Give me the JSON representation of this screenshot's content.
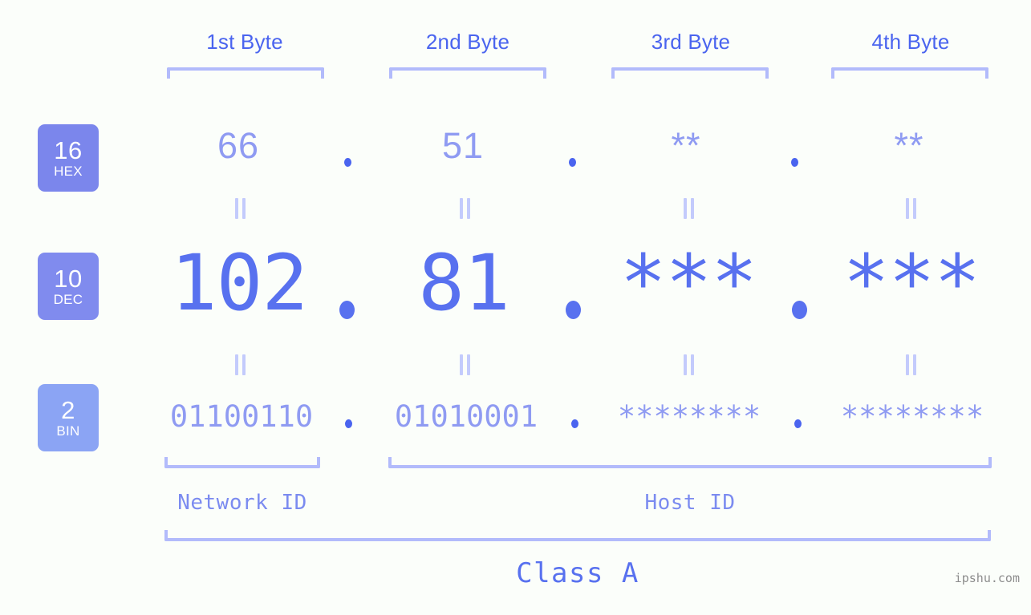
{
  "watermark": "ipshu.com",
  "byte_headings": [
    {
      "label": "1st Byte"
    },
    {
      "label": "2nd Byte"
    },
    {
      "label": "3rd Byte"
    },
    {
      "label": "4th Byte"
    }
  ],
  "bases": [
    {
      "number": "16",
      "name": "HEX",
      "color": "#7b86ec"
    },
    {
      "number": "10",
      "name": "DEC",
      "color": "#808bee"
    },
    {
      "number": "2",
      "name": "BIN",
      "color": "#8ba4f4"
    }
  ],
  "rows": {
    "hex": {
      "base_number": "16",
      "base_name": "HEX",
      "values": [
        "66",
        "51",
        "**",
        "**"
      ],
      "separator": "."
    },
    "dec": {
      "base_number": "10",
      "base_name": "DEC",
      "values": [
        "102",
        "81",
        "***",
        "***"
      ],
      "separator": "."
    },
    "bin": {
      "base_number": "2",
      "base_name": "BIN",
      "values": [
        "01100110",
        "01010001",
        "********",
        "********"
      ],
      "separator": "."
    }
  },
  "equality_marks": {
    "glyph": "=",
    "count_per_gap": 4
  },
  "segments": {
    "network_id": "Network ID",
    "host_id": "Host ID",
    "class": "Class A"
  },
  "colors": {
    "background": "#fbfefa",
    "accent_strong": "#4a64ef",
    "accent_medium": "#5871ef",
    "accent_light": "#8f9bf2",
    "bracket": "#b2bbfb",
    "badge_hex": "#7b86ec",
    "badge_dec": "#808bee",
    "badge_bin": "#8ba4f4",
    "watermark": "#8d8d8d"
  }
}
